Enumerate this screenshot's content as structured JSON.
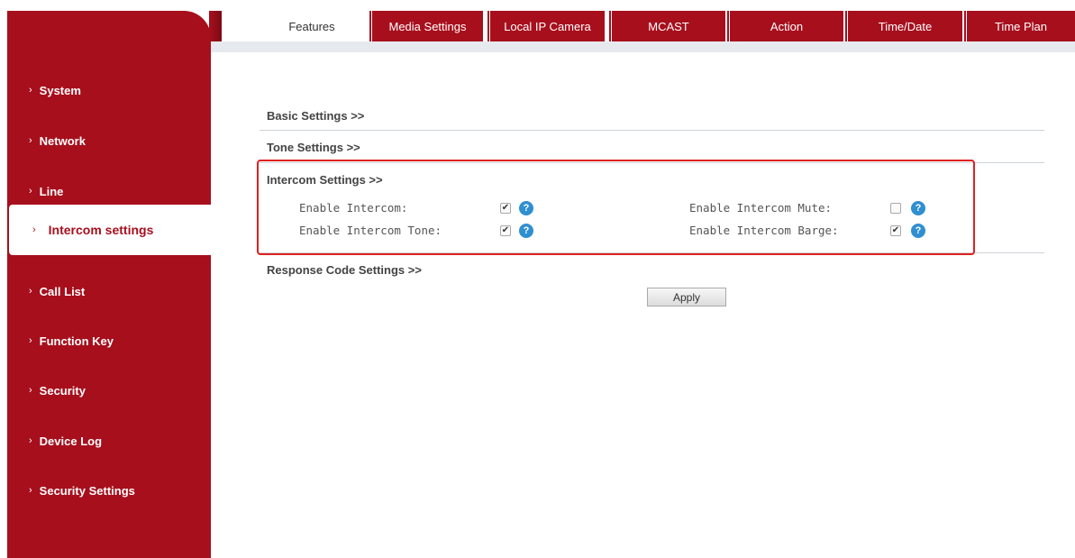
{
  "tabs": [
    {
      "label": "Features",
      "active": true
    },
    {
      "label": "Media Settings"
    },
    {
      "label": "Local IP Camera"
    },
    {
      "label": "MCAST"
    },
    {
      "label": "Action"
    },
    {
      "label": "Time/Date"
    },
    {
      "label": "Time Plan"
    }
  ],
  "sidebar": {
    "items": [
      {
        "label": "System"
      },
      {
        "label": "Network"
      },
      {
        "label": "Line"
      },
      {
        "label": "Intercom settings",
        "active": true
      },
      {
        "label": "Call List"
      },
      {
        "label": "Function Key"
      },
      {
        "label": "Security"
      },
      {
        "label": "Device Log"
      },
      {
        "label": "Security Settings"
      }
    ],
    "chevron": "›"
  },
  "sections": {
    "basic": "Basic Settings >>",
    "tone": "Tone Settings >>",
    "intercom": "Intercom Settings >>",
    "response": "Response Code Settings >>"
  },
  "intercom_fields": {
    "enable_intercom": {
      "label": "Enable Intercom:",
      "checked": true
    },
    "enable_intercom_tone": {
      "label": "Enable Intercom Tone:",
      "checked": true
    },
    "enable_intercom_mute": {
      "label": "Enable Intercom Mute:",
      "checked": false
    },
    "enable_intercom_barge": {
      "label": "Enable Intercom Barge:",
      "checked": true
    }
  },
  "apply_label": "Apply",
  "colors": {
    "brand_red": "#a70f1d",
    "highlight_red": "#e02020",
    "help_blue": "#2f8fd0"
  }
}
